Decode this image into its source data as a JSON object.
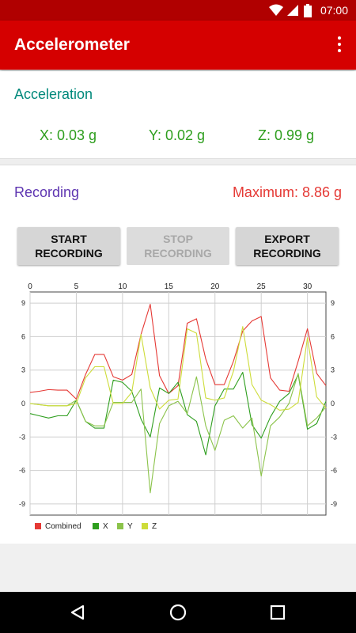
{
  "status": {
    "time": "07:00",
    "icons": [
      "wifi-icon",
      "signal-icon",
      "battery-icon"
    ]
  },
  "appbar": {
    "title": "Accelerometer",
    "menu_icon": "more-vert-icon"
  },
  "acceleration": {
    "heading": "Acceleration",
    "x": "X: 0.03 g",
    "y": "Y: 0.02 g",
    "z": "Z: 0.99 g"
  },
  "recording": {
    "heading": "Recording",
    "maximum": "Maximum: 8.86 g",
    "buttons": {
      "start": "START\nRECORDING",
      "stop": "STOP\nRECORDING",
      "export": "EXPORT\nRECORDING"
    }
  },
  "colors": {
    "combined": "#e53935",
    "x": "#2e9e1e",
    "y": "#8bc34a",
    "z": "#cddc39"
  },
  "chart_data": {
    "type": "line",
    "title": "",
    "xlabel": "",
    "ylabel": "",
    "xlim": [
      0,
      32
    ],
    "ylim": [
      -10,
      10
    ],
    "x_ticks": [
      "0",
      "5",
      "10",
      "15",
      "20",
      "25",
      "30"
    ],
    "x_tick_values": [
      0,
      5,
      10,
      15,
      20,
      25,
      30
    ],
    "y_ticks": [
      "9",
      "6",
      "3",
      "0",
      "-3",
      "-6",
      "-9"
    ],
    "y_tick_values": [
      9,
      6,
      3,
      0,
      -3,
      -6,
      -9
    ],
    "grid": true,
    "legend_position": "bottom-left",
    "x": [
      0,
      1,
      2,
      3,
      4,
      5,
      6,
      7,
      8,
      9,
      10,
      11,
      12,
      13,
      14,
      15,
      16,
      17,
      18,
      19,
      20,
      21,
      22,
      23,
      24,
      25,
      26,
      27,
      28,
      29,
      30,
      31,
      32
    ],
    "series": [
      {
        "name": "Combined",
        "color": "#e53935",
        "values": [
          1.0,
          1.1,
          1.25,
          1.2,
          1.2,
          0.4,
          2.6,
          4.4,
          4.4,
          2.4,
          2.1,
          2.6,
          6.2,
          8.9,
          2.5,
          0.9,
          1.6,
          7.2,
          7.6,
          4.0,
          1.7,
          1.7,
          3.8,
          6.5,
          7.4,
          7.8,
          2.3,
          1.2,
          1.1,
          3.8,
          6.7,
          2.7,
          1.6
        ]
      },
      {
        "name": "X",
        "color": "#2e9e1e",
        "values": [
          -0.9,
          -1.1,
          -1.3,
          -1.1,
          -1.1,
          0.3,
          -1.6,
          -2.2,
          -2.2,
          2.1,
          1.9,
          1.1,
          -1.4,
          -3.0,
          1.4,
          0.9,
          1.9,
          -1.0,
          -1.6,
          -4.6,
          -0.2,
          1.3,
          1.3,
          2.8,
          -1.9,
          -3.1,
          -1.2,
          0.2,
          0.9,
          2.6,
          -2.3,
          -1.8,
          0.2
        ]
      },
      {
        "name": "Y",
        "color": "#8bc34a",
        "values": [
          0.0,
          -0.1,
          -0.2,
          -0.2,
          -0.2,
          0.3,
          -1.6,
          -2.0,
          -2.0,
          0.1,
          0.1,
          0.1,
          1.3,
          -8.0,
          -1.8,
          -0.2,
          0.2,
          -0.9,
          2.4,
          -2.0,
          -4.2,
          -1.5,
          -1.1,
          -2.2,
          -1.3,
          -6.5,
          -2.0,
          -1.2,
          0.0,
          2.7,
          -2.0,
          -1.3,
          -0.3
        ]
      },
      {
        "name": "Z",
        "color": "#cddc39",
        "values": [
          0.0,
          -0.1,
          -0.2,
          -0.2,
          -0.2,
          0.0,
          2.3,
          3.3,
          3.3,
          0.0,
          0.0,
          1.0,
          6.2,
          1.4,
          -0.5,
          0.3,
          0.4,
          6.7,
          6.3,
          0.5,
          0.3,
          0.5,
          2.9,
          6.9,
          1.7,
          0.3,
          -0.1,
          -0.6,
          -0.5,
          0.1,
          5.9,
          0.6,
          -0.4
        ]
      }
    ]
  },
  "nav": {
    "back": "back-icon",
    "home": "home-icon",
    "recents": "recents-icon"
  }
}
